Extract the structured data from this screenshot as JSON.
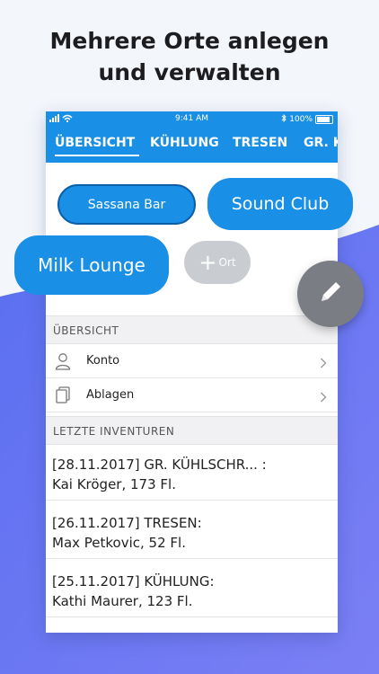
{
  "headline": {
    "line1": "Mehrere Orte anlegen",
    "line2": "und verwalten"
  },
  "status_bar": {
    "time": "9:41 AM",
    "battery": "100%"
  },
  "tabs": [
    {
      "label": "ÜBERSICHT",
      "active": true
    },
    {
      "label": "KÜHLUNG"
    },
    {
      "label": "TRESEN"
    },
    {
      "label": "GR. K"
    }
  ],
  "locations": {
    "sassana": "Sassana Bar",
    "sound": "Sound Club",
    "milk": "Milk Lounge",
    "add_label": "Ort"
  },
  "overview": {
    "header": "ÜBERSICHT",
    "items": [
      {
        "label": "Konto",
        "icon": "user-icon"
      },
      {
        "label": "Ablagen",
        "icon": "documents-icon"
      }
    ]
  },
  "inventories": {
    "header": "LETZTE INVENTUREN",
    "items": [
      {
        "line1": "[28.11.2017] GR. KÜHLSCHR... :",
        "line2": "Kai Kröger, 173 Fl."
      },
      {
        "line1": "[26.11.2017] TRESEN:",
        "line2": "Max Petkovic, 52 Fl."
      },
      {
        "line1": "[25.11.2017] KÜHLUNG:",
        "line2": "Kathi Maurer, 123 Fl."
      }
    ]
  },
  "colors": {
    "accent": "#1a8fe6",
    "chip_inactive": "#c9ccd1",
    "fab": "#7a7d84"
  }
}
